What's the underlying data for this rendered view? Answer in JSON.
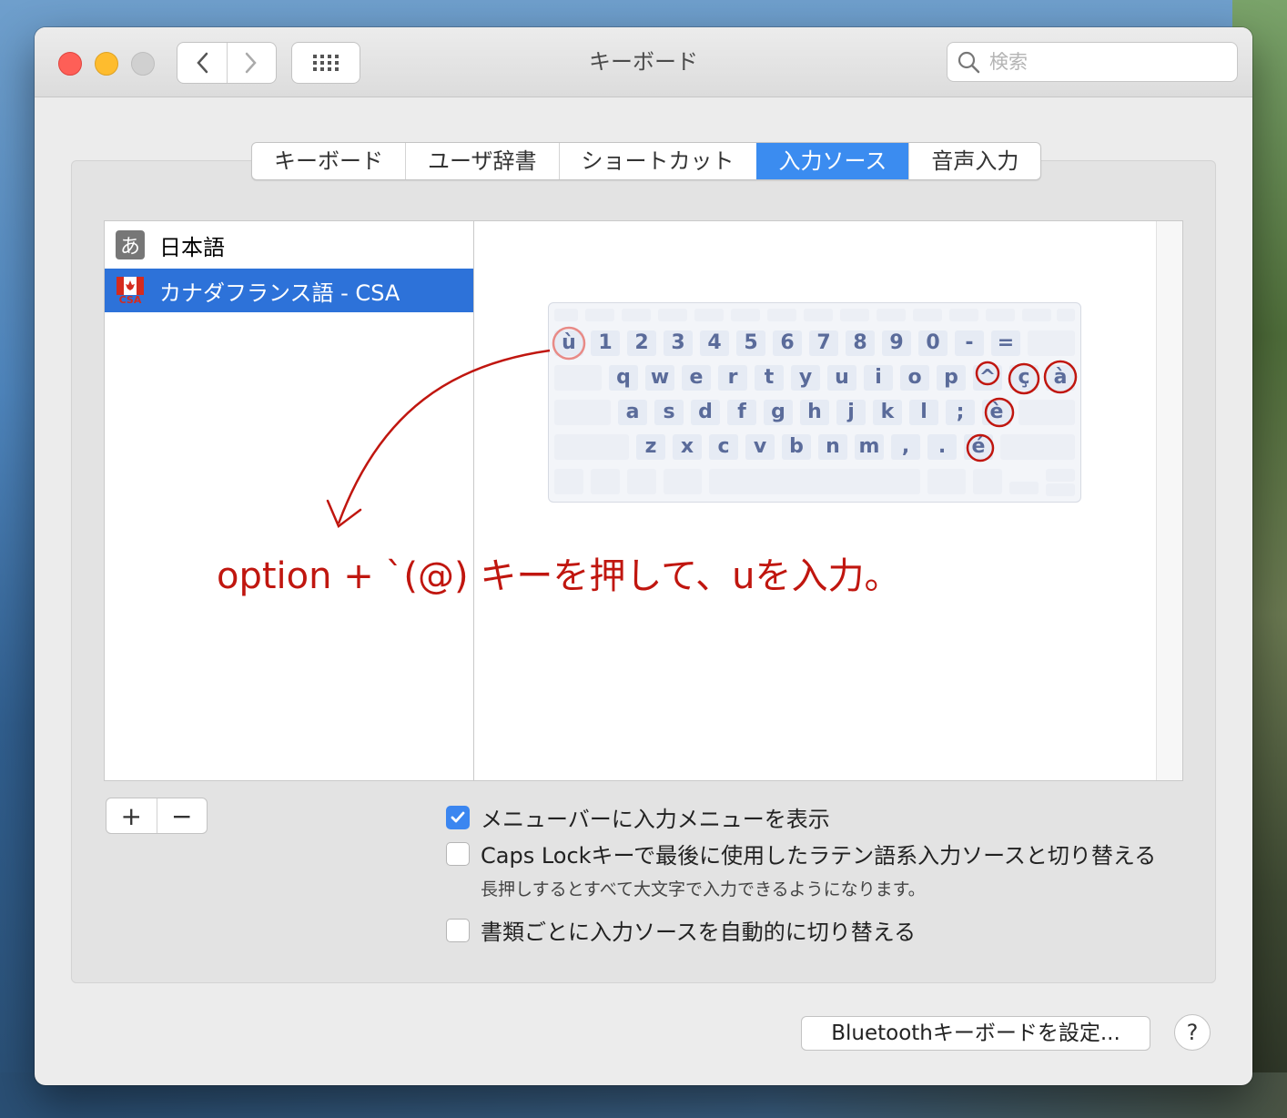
{
  "window": {
    "title": "キーボード"
  },
  "search": {
    "placeholder": "検索"
  },
  "tabs": [
    {
      "label": "キーボード",
      "active": false
    },
    {
      "label": "ユーザ辞書",
      "active": false
    },
    {
      "label": "ショートカット",
      "active": false
    },
    {
      "label": "入力ソース",
      "active": true
    },
    {
      "label": "音声入力",
      "active": false
    }
  ],
  "sources": [
    {
      "icon_text": "あ",
      "label": "日本語",
      "icon": "hiragana-icon",
      "selected": false
    },
    {
      "icon_text": "CSA",
      "label": "カナダフランス語 - CSA",
      "icon": "canada-flag-icon",
      "selected": true
    }
  ],
  "keyboard": {
    "row1": [
      "ù",
      "1",
      "2",
      "3",
      "4",
      "5",
      "6",
      "7",
      "8",
      "9",
      "0",
      "-",
      "="
    ],
    "row2": [
      "q",
      "w",
      "e",
      "r",
      "t",
      "y",
      "u",
      "i",
      "o",
      "p",
      "^",
      "ç",
      "à"
    ],
    "row3": [
      "a",
      "s",
      "d",
      "f",
      "g",
      "h",
      "j",
      "k",
      "l",
      ";",
      "è"
    ],
    "row4": [
      "z",
      "x",
      "c",
      "v",
      "b",
      "n",
      "m",
      ",",
      ".",
      "é"
    ],
    "circled": [
      "ù",
      "^",
      "ç",
      "à",
      "è",
      "é"
    ]
  },
  "annotation": {
    "text": "option + `(@) キーを押して、uを入力。",
    "color": "#c0160f"
  },
  "buttons": {
    "add": "+",
    "remove": "−",
    "bluetooth": "Bluetoothキーボードを設定...",
    "help": "?"
  },
  "options": [
    {
      "label": "メニューバーに入力メニューを表示",
      "checked": true
    },
    {
      "label": "Caps Lockキーで最後に使用したラテン語系入力ソースと切り替える",
      "checked": false
    },
    {
      "label": "書類ごとに入力ソースを自動的に切り替える",
      "checked": false
    }
  ],
  "caps_note": "長押しするとすべて大文字で入力できるようになります。",
  "colors": {
    "accent": "#3b8cf0",
    "selection": "#2d72d9",
    "annotation": "#c0160f"
  }
}
